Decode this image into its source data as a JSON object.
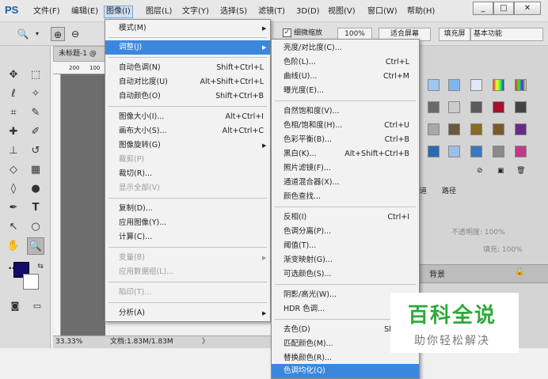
{
  "app": {
    "logo": "PS"
  },
  "menubar": {
    "items": [
      "文件(F)",
      "编辑(E)",
      "图像(I)",
      "图层(L)",
      "文字(Y)",
      "选择(S)",
      "滤镜(T)",
      "3D(D)",
      "视图(V)",
      "窗口(W)",
      "帮助(H)"
    ],
    "window_buttons": {
      "minimize": "_",
      "maximize": "□",
      "close": "✕"
    }
  },
  "options_bar": {
    "fine_zoom_label": "细微缩放",
    "zoom_100": "100%",
    "fit_screen": "适合屏幕",
    "fill_screen": "填充屏",
    "workspace": "基本功能"
  },
  "document": {
    "tab_title": "未标题-1 @",
    "ruler_marks": [
      "200",
      "100"
    ],
    "zoom": "33.33%",
    "doc_size": "文档:1.83M/1.83M",
    "nav_arrow": "〉"
  },
  "colors": {
    "foreground": "#140a6a",
    "background": "#ffffff",
    "highlight": "#3b87dd",
    "watermark_green": "#2fa93b"
  },
  "right_panel": {
    "tab_channels": "道",
    "tab_paths": "路径",
    "opacity_label": "不透明度: 100%",
    "fill_label": "填充: 100%",
    "layer_name": "背景"
  },
  "image_menu": {
    "items": [
      {
        "label": "模式(M)",
        "submenu": true
      },
      {
        "label": "调整(J)",
        "submenu": true,
        "highlighted": true
      },
      {
        "label": "自动色调(N)",
        "shortcut": "Shift+Ctrl+L"
      },
      {
        "label": "自动对比度(U)",
        "shortcut": "Alt+Shift+Ctrl+L"
      },
      {
        "label": "自动颜色(O)",
        "shortcut": "Shift+Ctrl+B"
      },
      {
        "label": "图像大小(I)...",
        "shortcut": "Alt+Ctrl+I"
      },
      {
        "label": "画布大小(S)...",
        "shortcut": "Alt+Ctrl+C"
      },
      {
        "label": "图像旋转(G)",
        "submenu": true
      },
      {
        "label": "裁剪(P)",
        "disabled": true
      },
      {
        "label": "裁切(R)..."
      },
      {
        "label": "显示全部(V)",
        "disabled": true
      },
      {
        "label": "复制(D)..."
      },
      {
        "label": "应用图像(Y)..."
      },
      {
        "label": "计算(C)..."
      },
      {
        "label": "变量(B)",
        "submenu": true,
        "disabled": true
      },
      {
        "label": "应用数据组(L)...",
        "disabled": true
      },
      {
        "label": "陷印(T)...",
        "disabled": true
      },
      {
        "label": "分析(A)",
        "submenu": true
      }
    ]
  },
  "adjust_menu": {
    "items": [
      {
        "label": "亮度/对比度(C)..."
      },
      {
        "label": "色阶(L)...",
        "shortcut": "Ctrl+L"
      },
      {
        "label": "曲线(U)...",
        "shortcut": "Ctrl+M"
      },
      {
        "label": "曝光度(E)..."
      },
      {
        "label": "自然饱和度(V)..."
      },
      {
        "label": "色相/饱和度(H)...",
        "shortcut": "Ctrl+U"
      },
      {
        "label": "色彩平衡(B)...",
        "shortcut": "Ctrl+B"
      },
      {
        "label": "黑白(K)...",
        "shortcut": "Alt+Shift+Ctrl+B"
      },
      {
        "label": "照片滤镜(F)..."
      },
      {
        "label": "通道混合器(X)..."
      },
      {
        "label": "颜色查找..."
      },
      {
        "label": "反相(I)",
        "shortcut": "Ctrl+I"
      },
      {
        "label": "色调分离(P)..."
      },
      {
        "label": "阈值(T)..."
      },
      {
        "label": "渐变映射(G)..."
      },
      {
        "label": "可选颜色(S)..."
      },
      {
        "label": "阴影/高光(W)..."
      },
      {
        "label": "HDR 色调..."
      },
      {
        "label": "去色(D)",
        "shortcut": "Shift+Ct"
      },
      {
        "label": "匹配颜色(M)..."
      },
      {
        "label": "替换颜色(R)..."
      },
      {
        "label": "色调均化(Q)",
        "highlighted": true
      }
    ]
  },
  "watermark": {
    "main": "百科全说",
    "sub": "助你轻松解决"
  }
}
